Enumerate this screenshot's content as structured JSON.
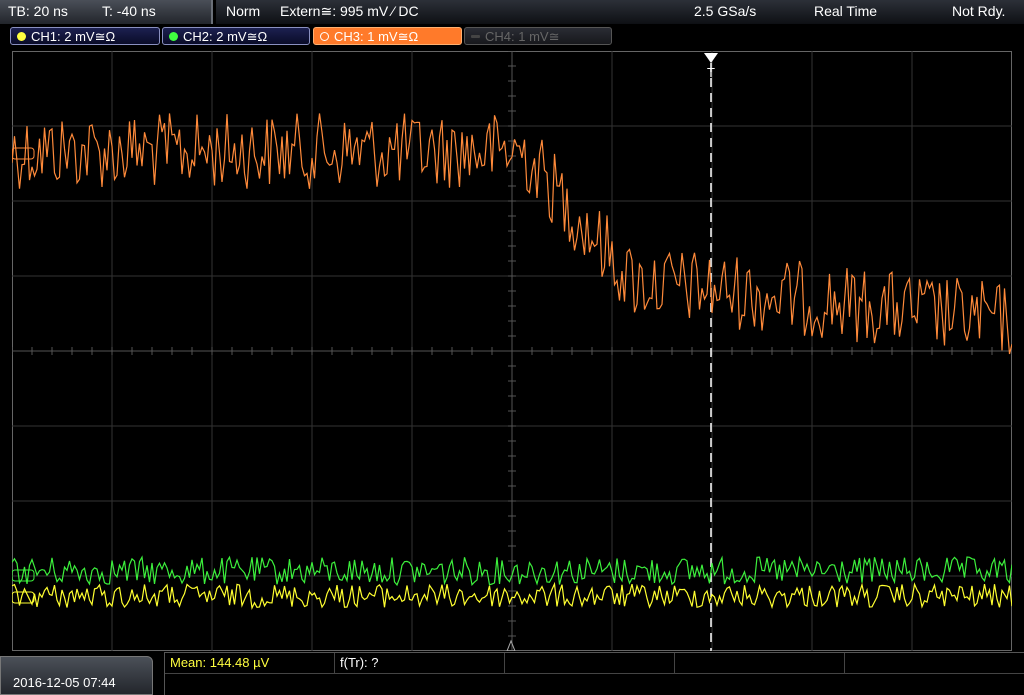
{
  "topbar": {
    "timebase": "TB: 20 ns",
    "trigger_time": "T: -40 ns",
    "trigger_mode": "Norm",
    "trigger_source": "Extern≅: 995 mV ⁄ DC",
    "sample_rate": "2.5 GSa/s",
    "acq_mode": "Real Time",
    "status": "Not Rdy."
  },
  "channels": [
    {
      "label": "CH1: 2 mV≅Ω",
      "color": "#ffff40"
    },
    {
      "label": "CH2: 2 mV≅Ω",
      "color": "#40ff40"
    },
    {
      "label": "CH3: 1 mV≅Ω",
      "color": "#ff7a2a"
    },
    {
      "label": "CH4: 1 mV≅",
      "color": "#555555"
    }
  ],
  "markers": {
    "trigger_T": "T"
  },
  "bottom": {
    "datetime": "2016-12-05 07:44",
    "mean": "Mean: 144.48 µV",
    "ftr": "f(Tr): ?"
  },
  "traces": {
    "ch3_color": "#ff8a3a",
    "ch2_color": "#3cf03c",
    "ch1_color": "#ffff30"
  }
}
